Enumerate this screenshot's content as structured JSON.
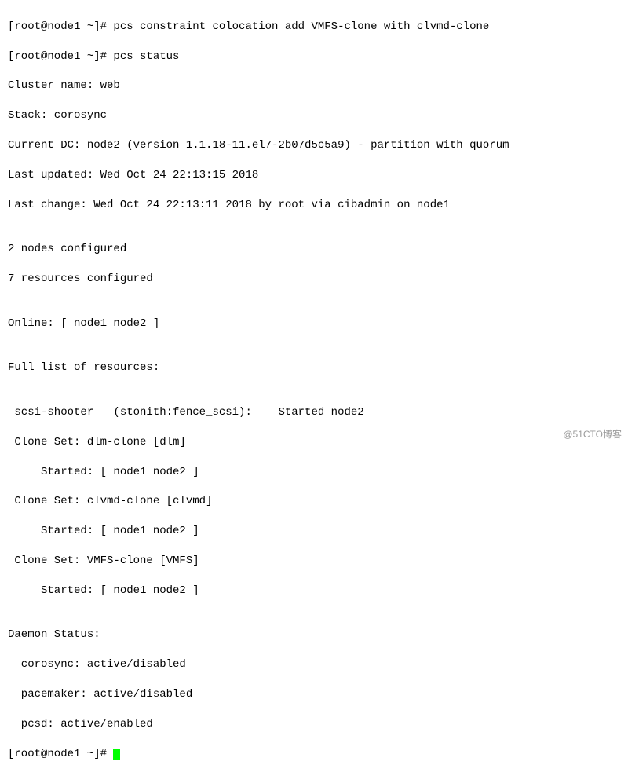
{
  "terminal": {
    "lines": [
      "[root@node1 ~]# pcs constraint colocation add VMFS-clone with clvmd-clone",
      "[root@node1 ~]# pcs status",
      "Cluster name: web",
      "Stack: corosync",
      "Current DC: node2 (version 1.1.18-11.el7-2b07d5c5a9) - partition with quorum",
      "Last updated: Wed Oct 24 22:13:15 2018",
      "Last change: Wed Oct 24 22:13:11 2018 by root via cibadmin on node1",
      "",
      "2 nodes configured",
      "7 resources configured",
      "",
      "Online: [ node1 node2 ]",
      "",
      "Full list of resources:",
      "",
      " scsi-shooter   (stonith:fence_scsi):    Started node2",
      " Clone Set: dlm-clone [dlm]",
      "     Started: [ node1 node2 ]",
      " Clone Set: clvmd-clone [clvmd]",
      "     Started: [ node1 node2 ]",
      " Clone Set: VMFS-clone [VMFS]",
      "     Started: [ node1 node2 ]",
      "",
      "Daemon Status:",
      "  corosync: active/disabled",
      "  pacemaker: active/disabled",
      "  pcsd: active/enabled"
    ],
    "prompt": "[root@node1 ~]# "
  },
  "watermark": "@51CTO博客"
}
